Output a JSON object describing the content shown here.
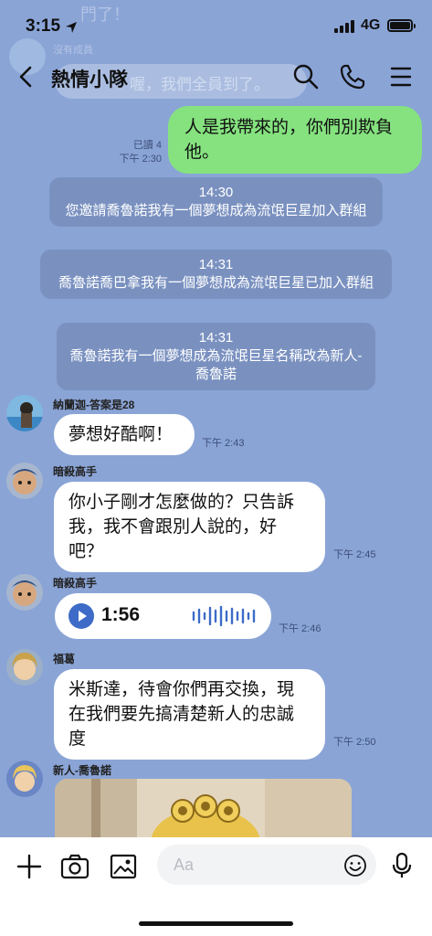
{
  "status_bar": {
    "time": "3:15",
    "network": "4G"
  },
  "background_snippets": {
    "top_text": "門了！",
    "sender": "沒有成員",
    "bubble_text": "喔，我們全員到了。"
  },
  "header": {
    "title": "熱情小隊"
  },
  "messages": {
    "m1": {
      "text": "人是我帶來的，你們別欺負他。",
      "read": "已讀 4",
      "time": "下午 2:30"
    },
    "sys1": {
      "time": "14:30",
      "text": "您邀請喬魯諾我有一個夢想成為流氓巨星加入群組"
    },
    "sys2": {
      "time": "14:31",
      "text": "喬魯諾喬巴拿我有一個夢想成為流氓巨星已加入群組"
    },
    "sys3": {
      "time": "14:31",
      "text": "喬魯諾我有一個夢想成為流氓巨星名稱改為新人-喬魯諾"
    },
    "m2": {
      "sender": "納蘭迦-答案是28",
      "text": "夢想好酷啊！",
      "time": "下午 2:43"
    },
    "m3": {
      "sender": "暗殺高手",
      "text": "你小子剛才怎麼做的？只告訴我，我不會跟別人說的，好吧？",
      "time": "下午 2:45"
    },
    "m4": {
      "sender": "暗殺高手",
      "duration": "1:56",
      "time": "下午 2:46"
    },
    "m5": {
      "sender": "福葛",
      "text": "米斯達，待會你們再交換，現在我們要先搞清楚新人的忠誠度",
      "time": "下午 2:50"
    },
    "m6": {
      "sender": "新人-喬魯諾"
    }
  },
  "input": {
    "placeholder": "Aa"
  },
  "colors": {
    "background": "#8aa4d6",
    "my_bubble": "#85e27f",
    "other_bubble": "#ffffff",
    "accent": "#3d6bc7"
  },
  "icons": [
    "back-arrow-icon",
    "search-icon",
    "phone-icon",
    "menu-icon",
    "plus-icon",
    "camera-icon",
    "image-icon",
    "emoji-icon",
    "mic-icon",
    "play-icon"
  ]
}
